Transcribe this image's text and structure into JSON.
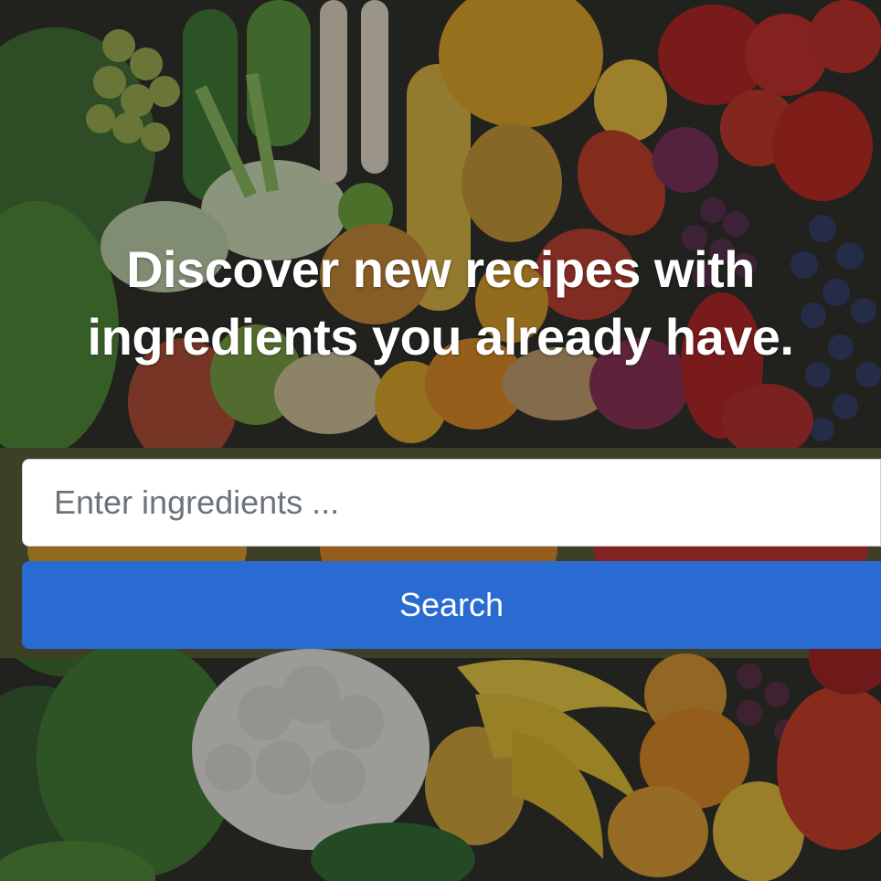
{
  "hero": {
    "headline_line1": "Discover new recipes with",
    "headline_line2": "ingredients you already have.",
    "background_subject": "assorted fresh vegetables and fruits"
  },
  "search": {
    "placeholder": "Enter ingredients ...",
    "value": "",
    "button_label": "Search"
  },
  "colors": {
    "button": "#2a6bd1",
    "headline_text": "#ffffff",
    "input_background": "#ffffff"
  }
}
